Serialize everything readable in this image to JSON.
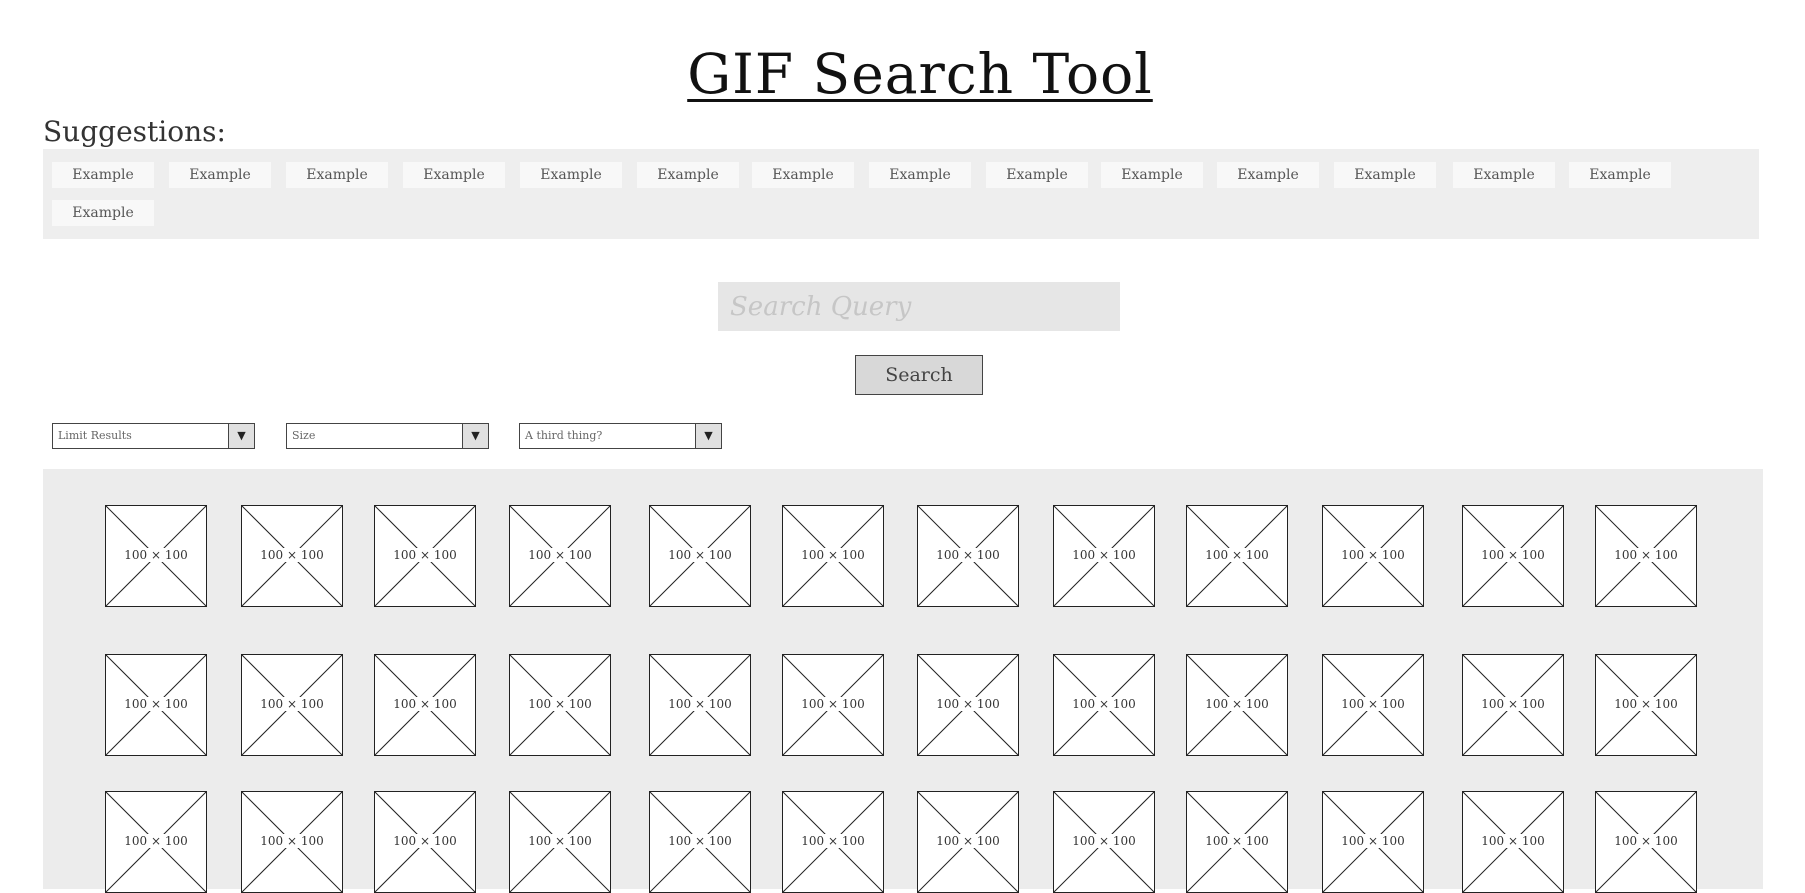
{
  "title": "GIF Search Tool",
  "suggestions": {
    "label": "Suggestions:",
    "items": [
      "Example",
      "Example",
      "Example",
      "Example",
      "Example",
      "Example",
      "Example",
      "Example",
      "Example",
      "Example",
      "Example",
      "Example",
      "Example",
      "Example",
      "Example"
    ]
  },
  "search": {
    "placeholder": "Search Query",
    "value": "",
    "button_label": "Search"
  },
  "filters": [
    {
      "selected": "Limit Results"
    },
    {
      "selected": "Size"
    },
    {
      "selected": "A third thing?"
    }
  ],
  "results": {
    "rows": 3,
    "columns": 12,
    "placeholder_label": "100 × 100"
  },
  "colors": {
    "panel_background": "#eeeeee",
    "results_background": "#ececec",
    "input_background": "#e6e6e6",
    "button_background": "#d8d8d8"
  }
}
